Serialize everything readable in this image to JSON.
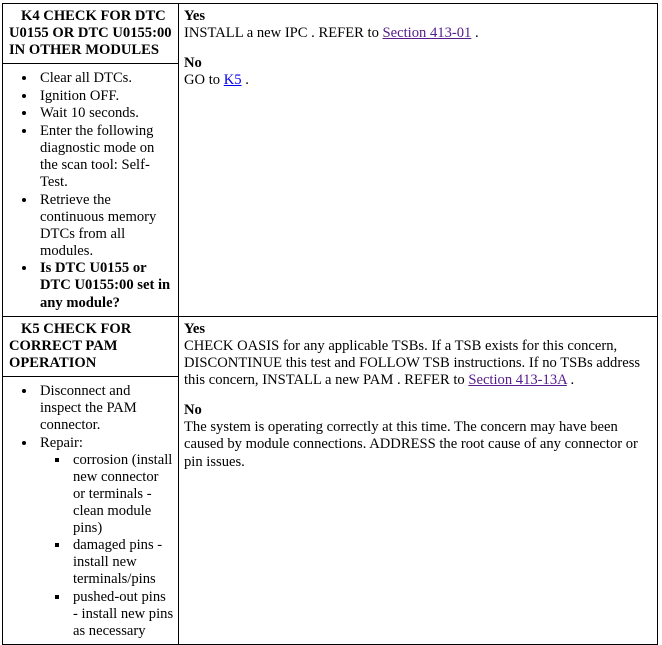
{
  "document": {
    "type": "diagnostic-pinpoint-test-table",
    "colors": {
      "text": "#000000",
      "border": "#000000",
      "background": "#ffffff",
      "visited_link": "#551a8b",
      "link": "#0000ee"
    }
  },
  "steps": [
    {
      "id": "k4",
      "title": "K4 CHECK FOR DTC U0155 OR DTC U0155:00 IN OTHER MODULES",
      "bullets": [
        {
          "text": "Clear all DTCs.",
          "bold": false
        },
        {
          "text": "Ignition OFF.",
          "bold": false
        },
        {
          "text": "Wait 10 seconds.",
          "bold": false
        },
        {
          "text": "Enter the following diagnostic mode on the scan tool: Self-Test.",
          "bold": false
        },
        {
          "text": "Retrieve the continuous memory DTCs from all modules.",
          "bold": false
        },
        {
          "text": "Is DTC U0155 or DTC U0155:00 set in any module?",
          "bold": true
        }
      ],
      "results": [
        {
          "label": "Yes",
          "parts": [
            {
              "kind": "text",
              "value": "INSTALL a new IPC . REFER to "
            },
            {
              "kind": "link",
              "value": "Section 413-01",
              "state": "visited"
            },
            {
              "kind": "text",
              "value": " ."
            }
          ]
        },
        {
          "label": "No",
          "parts": [
            {
              "kind": "text",
              "value": "GO to "
            },
            {
              "kind": "link",
              "value": "K5",
              "state": "link"
            },
            {
              "kind": "text",
              "value": " ."
            }
          ]
        }
      ]
    },
    {
      "id": "k5",
      "title": "K5 CHECK FOR CORRECT PAM OPERATION",
      "bullets": [
        {
          "text": "Disconnect and inspect the PAM connector.",
          "bold": false
        },
        {
          "text": "Repair:",
          "bold": false,
          "subbullets": [
            "corrosion (install new connector or terminals - clean module pins)",
            "damaged pins - install new terminals/pins",
            "pushed-out pins - install new pins as necessary"
          ]
        }
      ],
      "results": [
        {
          "label": "Yes",
          "parts": [
            {
              "kind": "text",
              "value": "CHECK OASIS for any applicable TSBs. If a TSB exists for this concern, DISCONTINUE this test and FOLLOW TSB instructions. If no TSBs address this concern, INSTALL a new PAM . REFER to "
            },
            {
              "kind": "link",
              "value": "Section 413-13A",
              "state": "visited"
            },
            {
              "kind": "text",
              "value": " ."
            }
          ]
        },
        {
          "label": "No",
          "parts": [
            {
              "kind": "text",
              "value": "The system is operating correctly at this time. The concern may have been caused by module connections. ADDRESS the root cause of any connector or pin issues."
            }
          ]
        }
      ]
    }
  ]
}
